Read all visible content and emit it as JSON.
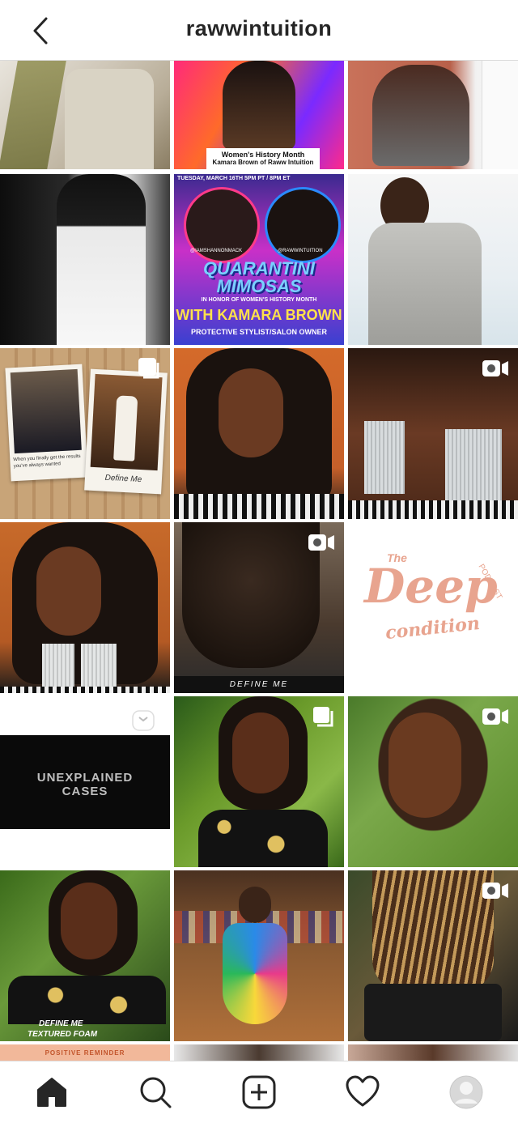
{
  "header": {
    "title": "rawwintuition",
    "back_icon": "chevron-left-icon"
  },
  "posts": {
    "womens_history": {
      "line1": "Women's History Month",
      "line2": "Kamara Brown of Raww Intuition"
    },
    "quarantini": {
      "date_line": "TUESDAY, MARCH 16TH 5PM PT / 8PM ET",
      "handle_left": "@IAMSHANNONMACK",
      "handle_right": "@RAWWINTUITION",
      "title1": "QUARANTINI",
      "title2": "MIMOSAS",
      "subtitle": "IN HONOR OF WOMEN'S HISTORY MONTH",
      "with_name": "WITH KAMARA BROWN",
      "role": "PROTECTIVE STYLIST/SALON OWNER"
    },
    "define_me_board": {
      "caption": "When you finally get the results you've always wanted",
      "label": "Define Me"
    },
    "deep_condition": {
      "the": "The",
      "deep": "Deep",
      "condition": "condition",
      "podcast": "PODCAST"
    },
    "unexplained": {
      "line1": "UNEXPLAINED",
      "line2": "CASES"
    },
    "define_me_banner": "DEFINE ME",
    "textured_foam": {
      "line1": "DEFINE ME",
      "line2": "TEXTURED FOAM"
    },
    "positive_reminder": "POSITIVE REMINDER"
  },
  "bottom_nav": {
    "items": [
      "home-icon",
      "search-icon",
      "new-post-icon",
      "activity-heart-icon",
      "profile-avatar"
    ]
  },
  "colors": {
    "text": "#262626",
    "border": "#dbdbdb",
    "pink": "#e8a48f"
  }
}
